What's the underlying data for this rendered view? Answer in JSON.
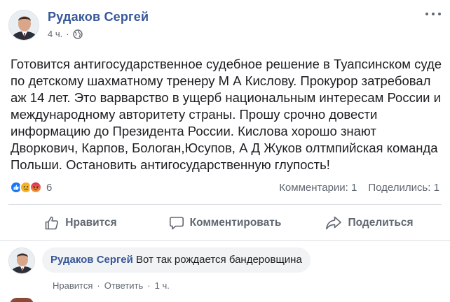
{
  "post": {
    "author": "Рудаков Сергей",
    "time": "4 ч.",
    "dot": "·",
    "text": "Готовится антигосударственное судебное решение в Туапсинском суде по детскому шахматному тренеру М А Кислову. Прокурор затребовал аж 14 лет. Это варварство в ущерб национальным интересам России и международному авторитету страны. Прошу срочно довести информацию до Президента России. Кислова хорошо знают Дворкович, Карпов, Бологан,Юсупов, А Д Жуков олтмпийская команда Польши. Остановить антигосударственную глупость!",
    "reactions": {
      "types": [
        "like-icon",
        "sad-icon",
        "angry-icon"
      ],
      "count": "6"
    },
    "stats": {
      "comments": "Комментарии: 1",
      "shares": "Поделились: 1"
    }
  },
  "actions": {
    "like": "Нравится",
    "comment": "Комментировать",
    "share": "Поделиться"
  },
  "comment": {
    "author": "Рудаков Сергей",
    "text": "Вот так рождается бандеровщина",
    "like": "Нравится",
    "reply": "Ответить",
    "time": "1 ч.",
    "sep": "·"
  },
  "colors": {
    "link": "#365899",
    "text": "#1c1e21",
    "muted": "#606770",
    "like": "#1877f2",
    "angry": "#e9710f",
    "sad": "#f7b125"
  }
}
